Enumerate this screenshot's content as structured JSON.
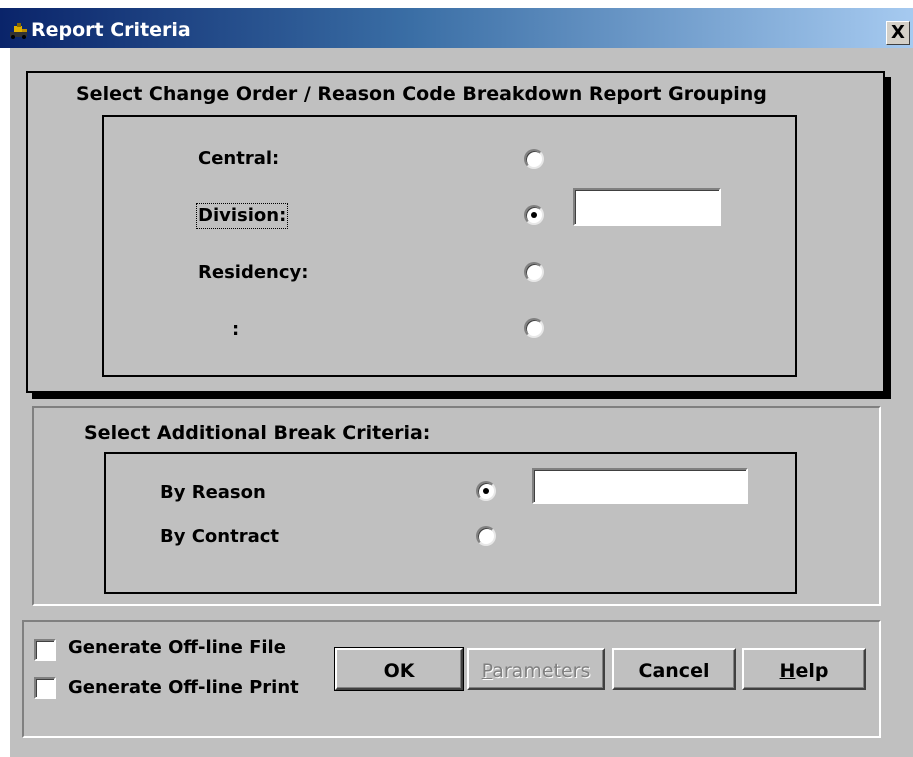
{
  "window": {
    "title": "Report Criteria",
    "close_glyph": "X"
  },
  "grouping": {
    "title": "Select Change Order / Reason Code Breakdown Report Grouping",
    "options": [
      {
        "label": "Central:",
        "checked": false
      },
      {
        "label": "Division:",
        "checked": true,
        "input_value": ""
      },
      {
        "label": "Residency:",
        "checked": false
      },
      {
        "label": ":",
        "checked": false
      }
    ]
  },
  "break_criteria": {
    "title": "Select Additional Break Criteria:",
    "options": [
      {
        "label": "By Reason",
        "checked": true,
        "input_value": ""
      },
      {
        "label": "By Contract",
        "checked": false
      }
    ]
  },
  "offline": {
    "file_label": "Generate Off-line File",
    "file_checked": false,
    "print_label": "Generate Off-line Print",
    "print_checked": false
  },
  "buttons": {
    "ok": "OK",
    "parameters_mnemonic": "P",
    "parameters_rest": "arameters",
    "cancel": "Cancel",
    "help_mnemonic": "H",
    "help_rest": "elp"
  },
  "icons": {
    "app": "bulldozer-icon",
    "close": "close-icon"
  }
}
